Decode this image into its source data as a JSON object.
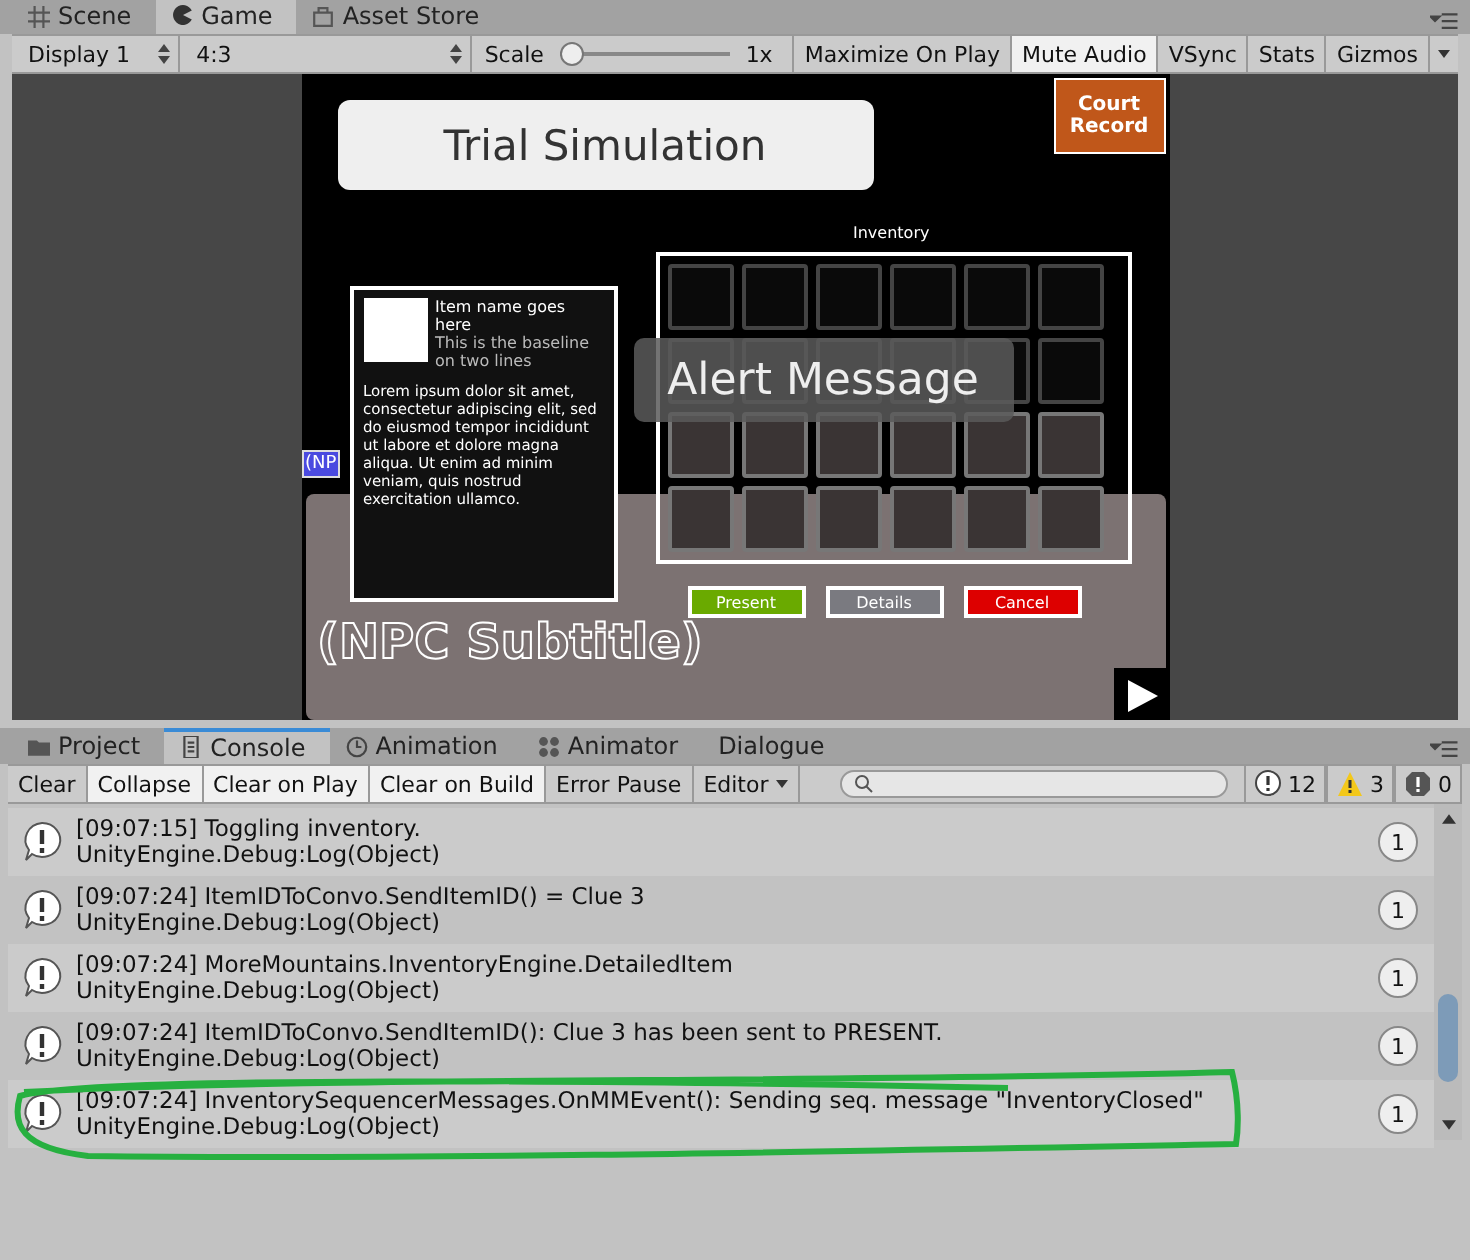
{
  "top_tabs": [
    {
      "label": "Scene",
      "selected": false
    },
    {
      "label": "Game",
      "selected": true
    },
    {
      "label": "Asset Store",
      "selected": false
    }
  ],
  "game_toolbar": {
    "display": "Display 1",
    "aspect": "4:3",
    "scale_label": "Scale",
    "scale": {
      "level": 0.0
    },
    "scale_value": "1x",
    "toggles": [
      {
        "label": "Maximize On Play",
        "on": false
      },
      {
        "label": "Mute Audio",
        "on": true
      },
      {
        "label": "VSync",
        "on": false
      },
      {
        "label": "Stats",
        "on": false
      },
      {
        "label": "Gizmos",
        "on": false
      }
    ]
  },
  "game": {
    "title_banner": "Trial Simulation",
    "court_record": "Court Record",
    "inventory_label": "Inventory",
    "item_panel": {
      "name": "Item name goes here",
      "baseline": "This is the baseline on two lines",
      "description": "Lorem ipsum dolor sit amet, consectetur adipiscing elit, sed do eiusmod tempor incididunt ut labore et dolore magna aliqua. Ut enim ad minim veniam, quis nostrud exercitation ullamco."
    },
    "alert": "Alert Message",
    "name_tag": "(NP",
    "subtitle": "(NPC Subtitle)",
    "actions": [
      {
        "label": "Present",
        "color": "#6aaa00"
      },
      {
        "label": "Details",
        "color": "#7a7a80"
      },
      {
        "label": "Cancel",
        "color": "#dd0000"
      }
    ],
    "inventory_open": true
  },
  "bottom_tabs": [
    {
      "label": "Project",
      "selected": false
    },
    {
      "label": "Console",
      "selected": true
    },
    {
      "label": "Animation",
      "selected": false
    },
    {
      "label": "Animator",
      "selected": false
    },
    {
      "label": "Dialogue",
      "selected": false
    }
  ],
  "console_toolbar": {
    "buttons": [
      {
        "label": "Clear",
        "on": false
      },
      {
        "label": "Collapse",
        "on": true
      },
      {
        "label": "Clear on Play",
        "on": true
      },
      {
        "label": "Clear on Build",
        "on": true
      },
      {
        "label": "Error Pause",
        "on": false
      }
    ],
    "editor": "Editor",
    "counts": [
      {
        "kind": "info",
        "value": "12"
      },
      {
        "kind": "warning",
        "value": "3"
      },
      {
        "kind": "error",
        "value": "0"
      }
    ]
  },
  "log": [
    {
      "message": "[09:07:15] Toggling inventory.",
      "trace": "UnityEngine.Debug:Log(Object)",
      "count": "1",
      "highlighted": false
    },
    {
      "message": "[09:07:24] ItemIDToConvo.SendItemID() =  Clue 3",
      "trace": "UnityEngine.Debug:Log(Object)",
      "count": "1",
      "highlighted": false
    },
    {
      "message": "[09:07:24] MoreMountains.InventoryEngine.DetailedItem",
      "trace": "UnityEngine.Debug:Log(Object)",
      "count": "1",
      "highlighted": false
    },
    {
      "message": "[09:07:24] ItemIDToConvo.SendItemID(): Clue 3 has been sent to PRESENT.",
      "trace": "UnityEngine.Debug:Log(Object)",
      "count": "1",
      "highlighted": false
    },
    {
      "message": "[09:07:24] InventorySequencerMessages.OnMMEvent(): Sending seq. message \"InventoryClosed\"",
      "trace": "UnityEngine.Debug:Log(Object)",
      "count": "1",
      "highlighted": true
    }
  ]
}
